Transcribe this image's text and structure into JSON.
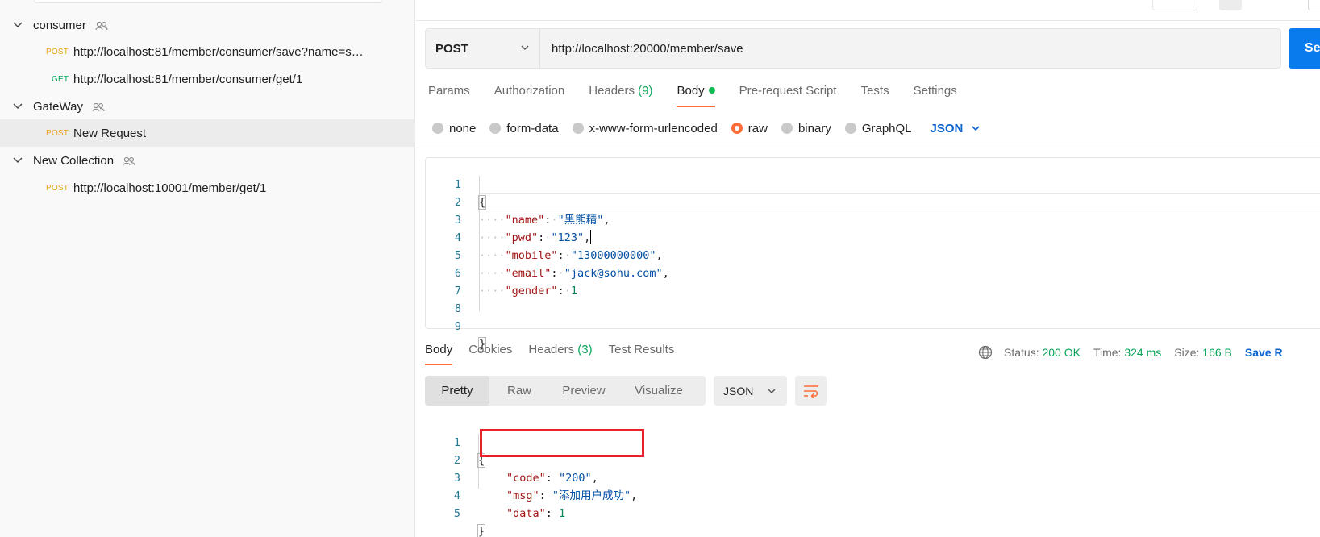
{
  "sidebar": {
    "collections": [
      {
        "name": "consumer",
        "requests": [
          {
            "method": "POST",
            "label": "http://localhost:81/member/consumer/save?name=s…"
          },
          {
            "method": "GET",
            "label": "http://localhost:81/member/consumer/get/1"
          }
        ]
      },
      {
        "name": "GateWay",
        "requests": [
          {
            "method": "POST",
            "label": "New Request"
          }
        ]
      },
      {
        "name": "New Collection",
        "requests": [
          {
            "method": "POST",
            "label": "http://localhost:10001/member/get/1"
          }
        ]
      }
    ]
  },
  "request": {
    "method": "POST",
    "url": "http://localhost:20000/member/save",
    "send_label": "Se",
    "tabs": {
      "params": "Params",
      "authorization": "Authorization",
      "headers": "Headers",
      "headers_count": "(9)",
      "body": "Body",
      "prerequest": "Pre-request Script",
      "tests": "Tests",
      "settings": "Settings"
    },
    "body_types": {
      "none": "none",
      "form_data": "form-data",
      "urlencoded": "x-www-form-urlencoded",
      "raw": "raw",
      "binary": "binary",
      "graphql": "GraphQL",
      "language": "JSON"
    },
    "body_lines": {
      "l1": {
        "num": "1",
        "brace": "{"
      },
      "l2": {
        "num": "2",
        "ws": "····",
        "key": "\"name\"",
        "sep": ":",
        "ws2": "·",
        "val": "\"黑熊精\"",
        "end": ","
      },
      "l3": {
        "num": "3",
        "ws": "····",
        "key": "\"pwd\"",
        "sep": ":",
        "ws2": "·",
        "val": "\"123\"",
        "end": ","
      },
      "l4": {
        "num": "4",
        "ws": "····",
        "key": "\"mobile\"",
        "sep": ":",
        "ws2": "·",
        "val": "\"13000000000\"",
        "end": ","
      },
      "l5": {
        "num": "5",
        "ws": "····",
        "key": "\"email\"",
        "sep": ":",
        "ws2": "·",
        "val": "\"jack@sohu.com\"",
        "end": ","
      },
      "l6": {
        "num": "6",
        "ws": "····",
        "key": "\"gender\"",
        "sep": ":",
        "ws2": "·",
        "val": "1"
      },
      "l7": {
        "num": "7"
      },
      "l8": {
        "num": "8"
      },
      "l9": {
        "num": "9",
        "brace": "}"
      }
    }
  },
  "response": {
    "tabs": {
      "body": "Body",
      "cookies": "Cookies",
      "headers": "Headers",
      "headers_count": "(3)",
      "test_results": "Test Results"
    },
    "status": {
      "status_label": "Status:",
      "status_value": "200 OK",
      "time_label": "Time:",
      "time_value": "324 ms",
      "size_label": "Size:",
      "size_value": "166 B",
      "save_label": "Save R"
    },
    "views": {
      "pretty": "Pretty",
      "raw": "Raw",
      "preview": "Preview",
      "visualize": "Visualize"
    },
    "format": "JSON",
    "lines": {
      "l1": {
        "num": "1",
        "brace": "{"
      },
      "l2": {
        "num": "2",
        "key": "\"code\"",
        "sep": ": ",
        "val": "\"200\"",
        "end": ","
      },
      "l3": {
        "num": "3",
        "key": "\"msg\"",
        "sep": ": ",
        "val": "\"添加用户成功\"",
        "end": ","
      },
      "l4": {
        "num": "4",
        "key": "\"data\"",
        "sep": ": ",
        "val": "1"
      },
      "l5": {
        "num": "5",
        "brace": "}"
      }
    }
  },
  "colors": {
    "accent": "#ff6c37",
    "send_button": "#097bed",
    "highlight": "#e8212b",
    "post_method": "#e8a317",
    "get_method": "#0aa55a"
  }
}
